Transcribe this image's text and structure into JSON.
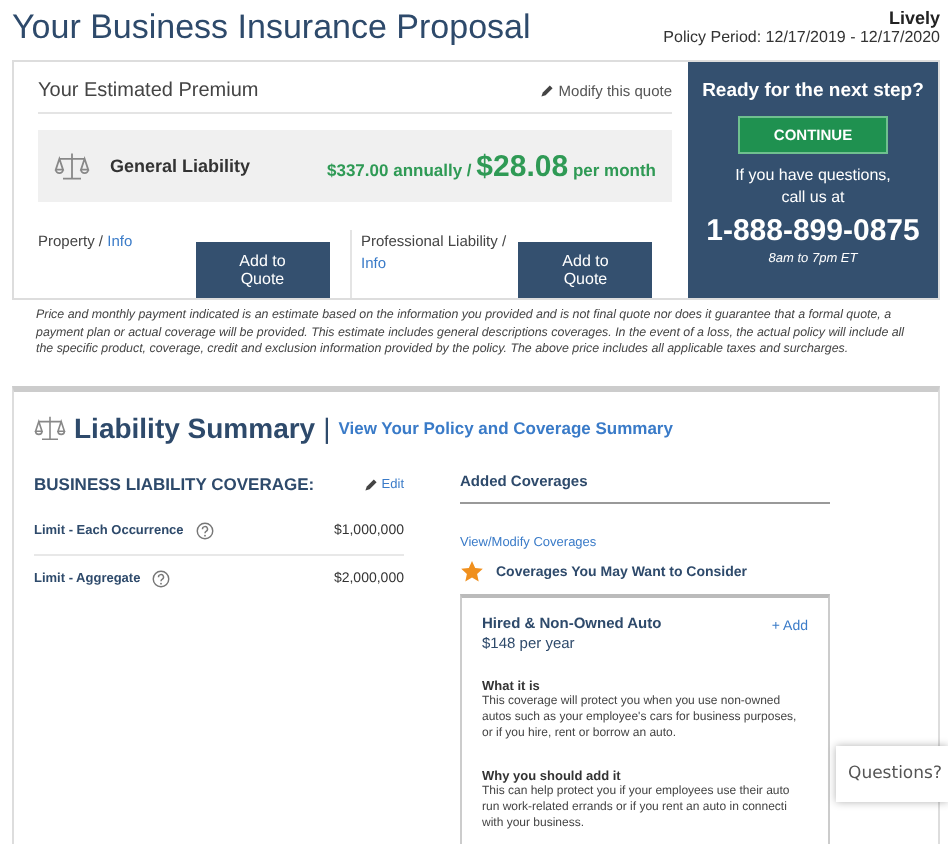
{
  "header": {
    "title": "Your Business Insurance Proposal",
    "company": "Lively",
    "policy_period": "Policy Period: 12/17/2019 - 12/17/2020"
  },
  "premium": {
    "title": "Your Estimated Premium",
    "modify_link": "Modify this quote",
    "product": "General Liability",
    "annual": "$337.00 annually /",
    "monthly_amount": "$28.08",
    "monthly_unit": "per month",
    "options": [
      {
        "name": "Property /",
        "info": "Info",
        "button": "Add to Quote"
      },
      {
        "name": "Professional Liability /",
        "info": "Info",
        "button": "Add to Quote"
      }
    ]
  },
  "next_step": {
    "title": "Ready for the next step?",
    "button": "CONTINUE",
    "text": "If you have questions, call us at",
    "phone": "1-888-899-0875",
    "hours": "8am to 7pm ET"
  },
  "disclaimer": "Price and monthly payment indicated is an estimate based on the information you provided and is not final quote nor does it guarantee that a formal quote, a payment plan or actual coverage will be provided. This estimate includes general descriptions coverages. In the event of a loss, the actual policy will include all the specific product, coverage, credit and exclusion information provided by the policy. The above price includes all applicable taxes and surcharges.",
  "summary": {
    "title": "Liability Summary",
    "separator": "|",
    "link": "View Your Policy and Coverage Summary",
    "coverage": {
      "heading": "BUSINESS LIABILITY COVERAGE:",
      "edit": "Edit",
      "rows": [
        {
          "label": "Limit - Each Occurrence",
          "value": "$1,000,000"
        },
        {
          "label": "Limit - Aggregate",
          "value": "$2,000,000"
        }
      ]
    },
    "added": {
      "heading": "Added Coverages",
      "link": "View/Modify Coverages",
      "consider": "Coverages You May Want to Consider",
      "card": {
        "name": "Hired & Non-Owned Auto",
        "price": "$148 per year",
        "add": "+ Add",
        "sections": [
          {
            "heading": "What it is",
            "lines": [
              "This coverage will protect you when you use non-owned autos such as your employee's cars for business purposes, or if you hire, rent or borrow an auto."
            ]
          },
          {
            "heading": "Why you should add it",
            "lines": [
              "This can help protect you if your employees use their auto",
              "run work-related errands or if you rent an auto in connecti",
              "with your business."
            ]
          }
        ]
      }
    }
  },
  "chat": {
    "label": "Questions?"
  }
}
